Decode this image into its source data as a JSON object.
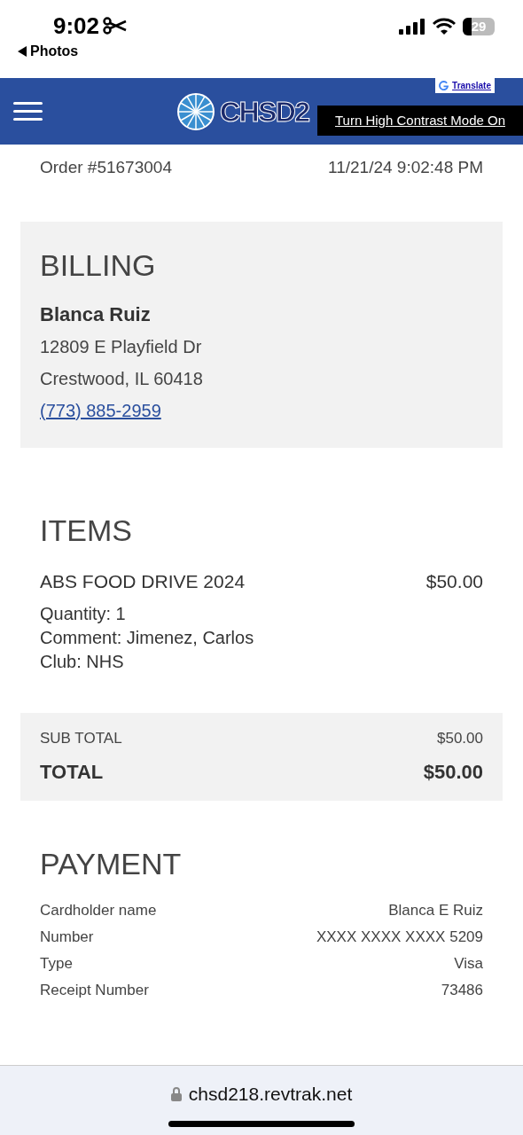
{
  "status_bar": {
    "time": "9:02",
    "back_label": "Photos",
    "battery": "29"
  },
  "header": {
    "logo_text": "CHSD2",
    "translate": "Translate",
    "contrast_button": "Turn High Contrast Mode On"
  },
  "order": {
    "number": "Order #51673004",
    "date": "11/21/24 9:02:48 PM"
  },
  "billing": {
    "title": "BILLING",
    "name": "Blanca Ruiz",
    "address_lines": [
      "12809 E Playfield Dr",
      "Crestwood, IL 60418"
    ],
    "phone": "(773) 885-2959"
  },
  "items": {
    "title": "ITEMS",
    "list": [
      {
        "name": "ABS FOOD DRIVE 2024",
        "price": "$50.00",
        "details": [
          "Quantity: 1",
          "Comment: Jimenez, Carlos",
          "Club: NHS"
        ]
      }
    ]
  },
  "totals": [
    {
      "kind": "sub",
      "label": "SUB TOTAL",
      "value": "$50.00"
    },
    {
      "kind": "total",
      "label": "TOTAL",
      "value": "$50.00"
    }
  ],
  "payment": {
    "title": "PAYMENT",
    "rows": [
      {
        "label": "Cardholder name",
        "value": "Blanca E Ruiz"
      },
      {
        "label": "Number",
        "value": "XXXX XXXX XXXX 5209"
      },
      {
        "label": "Type",
        "value": "Visa"
      },
      {
        "label": "Receipt Number",
        "value": "73486"
      }
    ]
  },
  "browser": {
    "url": "chsd218.revtrak.net"
  }
}
